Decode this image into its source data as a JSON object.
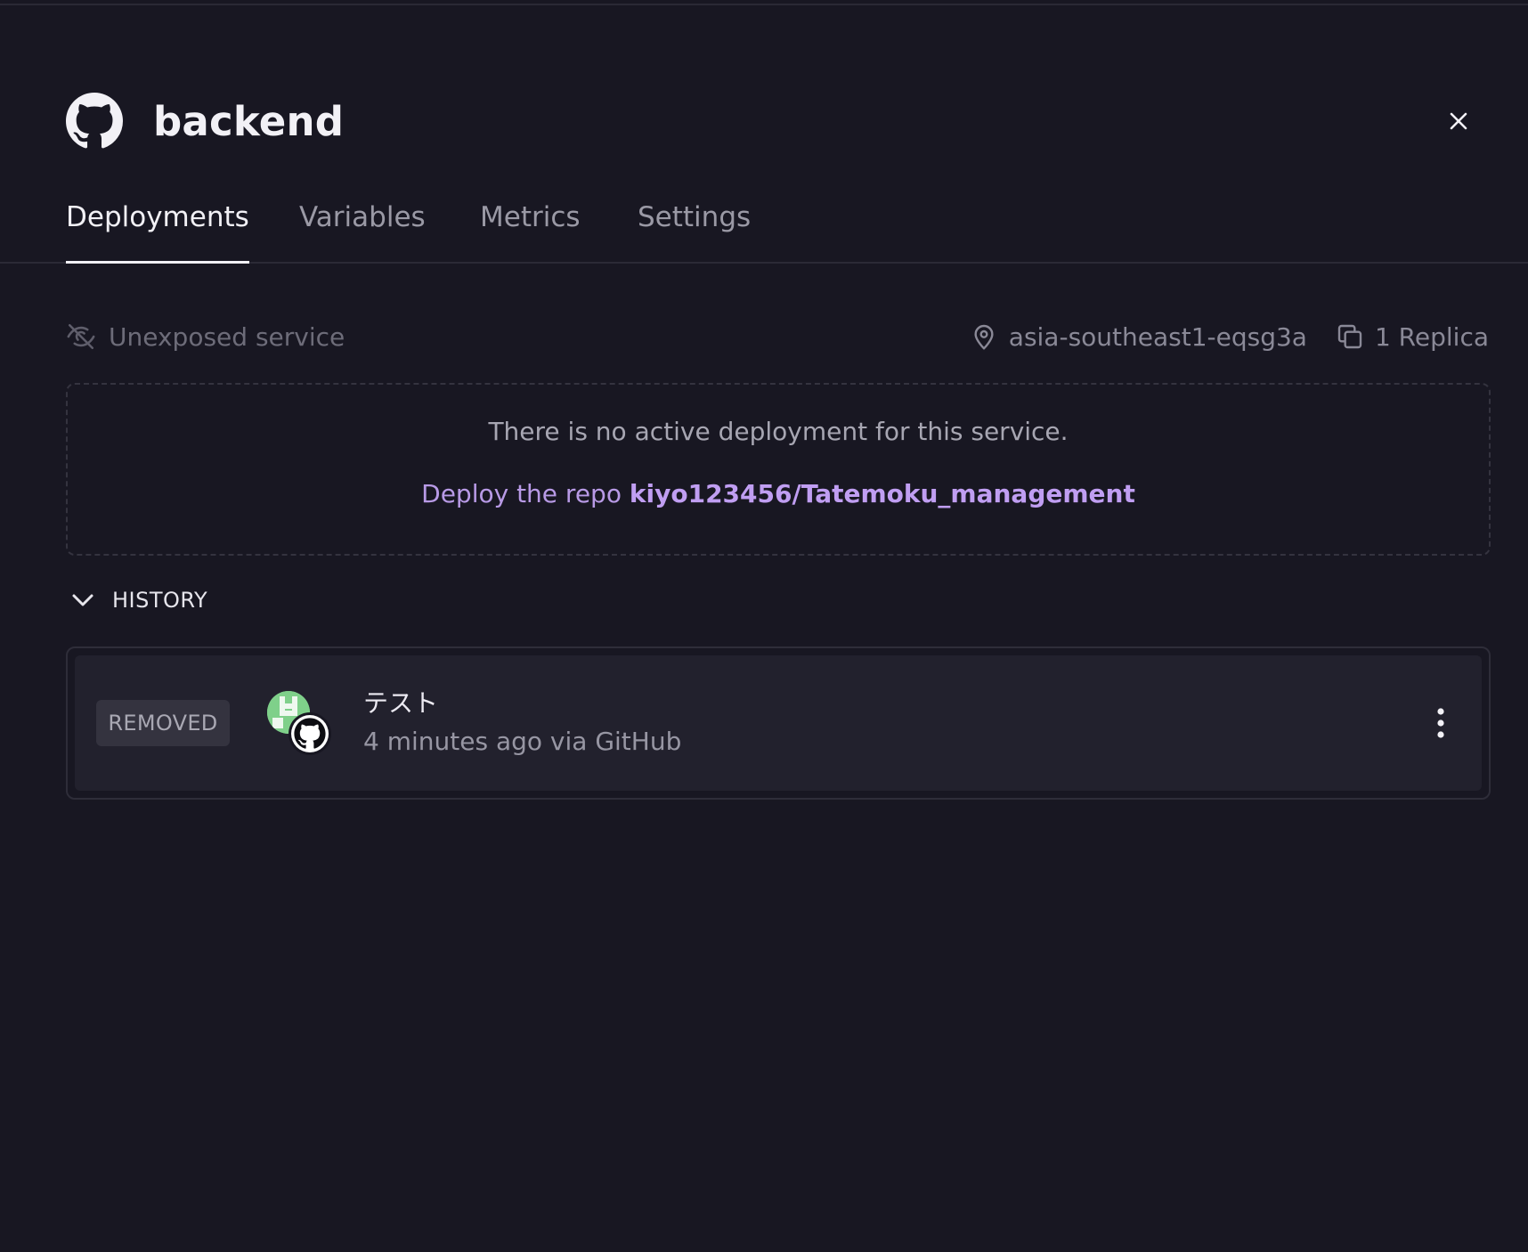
{
  "service": {
    "title": "backend",
    "icon": "github-icon"
  },
  "tabs": [
    {
      "label": "Deployments",
      "active": true
    },
    {
      "label": "Variables",
      "active": false
    },
    {
      "label": "Metrics",
      "active": false
    },
    {
      "label": "Settings",
      "active": false
    }
  ],
  "meta": {
    "exposure": "Unexposed service",
    "region": "asia-southeast1-eqsg3a",
    "replicas": "1 Replica"
  },
  "empty_state": {
    "message": "There is no active deployment for this service.",
    "deploy_prefix": "Deploy the repo",
    "repo": "kiyo123456/Tatemoku_management"
  },
  "history": {
    "label": "HISTORY",
    "items": [
      {
        "status": "REMOVED",
        "message": "テスト",
        "meta": "4 minutes ago via GitHub"
      }
    ]
  },
  "colors": {
    "background": "#181722",
    "accent": "#c09ef2",
    "avatar": "#7fd08a"
  }
}
